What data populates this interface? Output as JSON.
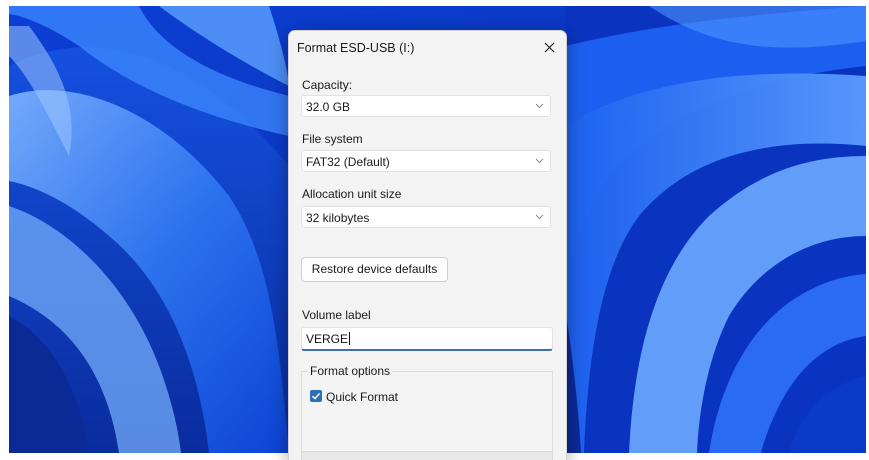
{
  "dialog": {
    "title": "Format ESD-USB (I:)",
    "close_icon": "close-icon",
    "capacity": {
      "label": "Capacity:",
      "value": "32.0 GB"
    },
    "file_system": {
      "label": "File system",
      "value": "FAT32 (Default)"
    },
    "allocation_unit_size": {
      "label": "Allocation unit size",
      "value": "32 kilobytes"
    },
    "restore_button_label": "Restore device defaults",
    "volume_label": {
      "label": "Volume label",
      "value": "VERGE"
    },
    "format_options": {
      "title": "Format options",
      "quick_format": {
        "label": "Quick Format",
        "checked": true
      }
    }
  },
  "colors": {
    "accent": "#2f6fb6",
    "wallpaper_base": "#0a3fd0"
  }
}
